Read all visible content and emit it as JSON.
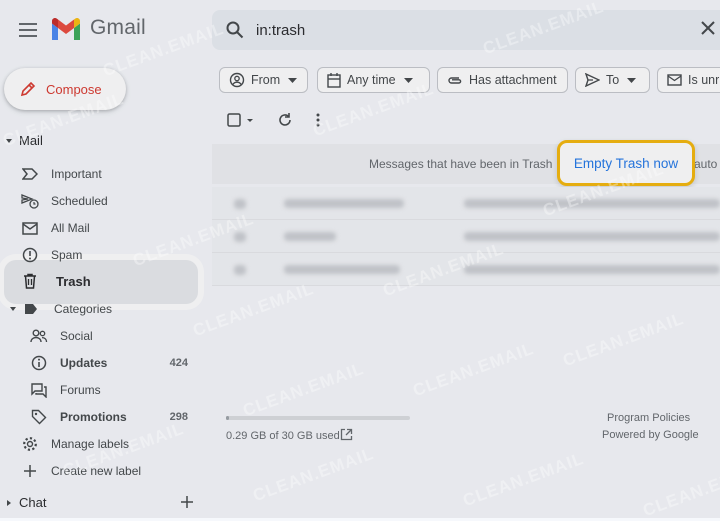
{
  "header": {
    "app_name": "Gmail",
    "search_value": "in:trash"
  },
  "compose": {
    "label": "Compose"
  },
  "sidebar": {
    "mail_heading": "Mail",
    "items": [
      {
        "label": "Important",
        "icon": "label-important-icon"
      },
      {
        "label": "Scheduled",
        "icon": "schedule-send-icon"
      },
      {
        "label": "All Mail",
        "icon": "all-mail-icon"
      },
      {
        "label": "Spam",
        "icon": "spam-icon"
      },
      {
        "label": "Trash",
        "icon": "trash-icon",
        "selected": true
      }
    ],
    "categories_heading": "Categories",
    "categories": [
      {
        "label": "Social",
        "count": "",
        "icon": "people-icon"
      },
      {
        "label": "Updates",
        "count": "424",
        "icon": "info-icon",
        "bold": true
      },
      {
        "label": "Forums",
        "count": "",
        "icon": "forum-icon"
      },
      {
        "label": "Promotions",
        "count": "298",
        "icon": "tag-icon",
        "bold": true
      }
    ],
    "manage_labels": "Manage labels",
    "create_label": "Create new label",
    "chat_heading": "Chat"
  },
  "filters": [
    {
      "label": "From",
      "icon": "account-circle-icon",
      "dropdown": true
    },
    {
      "label": "Any time",
      "icon": "calendar-icon",
      "dropdown": true
    },
    {
      "label": "Has attachment",
      "icon": "paperclip-icon",
      "dropdown": false
    },
    {
      "label": "To",
      "icon": "send-icon",
      "dropdown": true
    },
    {
      "label": "Is unr",
      "icon": "mail-icon",
      "dropdown": false
    }
  ],
  "banner": {
    "text": "Messages that have been in Trash",
    "text_cut": "auto",
    "empty_button": "Empty Trash now"
  },
  "footer": {
    "storage": "0.29 GB of 30 GB used",
    "storage_fraction": 0.01,
    "program_policies": "Program Policies",
    "powered_by": "Powered by Google"
  },
  "watermark": "CLEAN.EMAIL",
  "colors": {
    "accent": "#1a73e8",
    "compose_text": "#d93025",
    "highlight_border": "#f4b400"
  }
}
